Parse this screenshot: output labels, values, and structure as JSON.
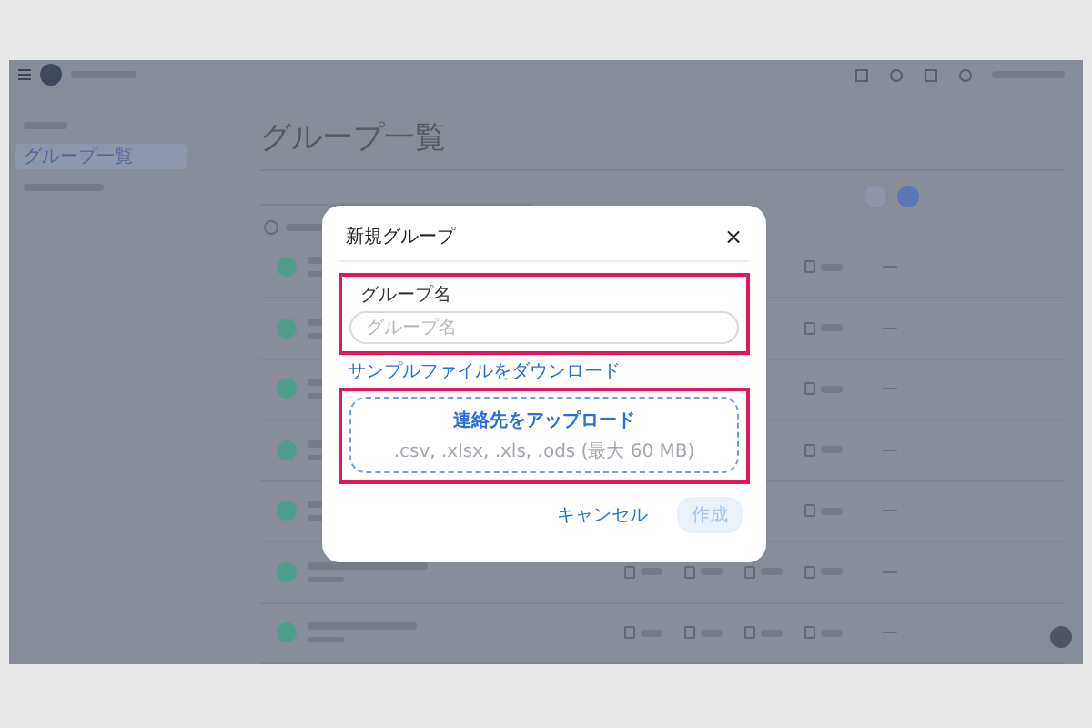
{
  "sidebar": {
    "items": [
      {
        "selected": false
      },
      {
        "label": "グループ一覧",
        "selected": true
      },
      {
        "selected": false
      }
    ]
  },
  "page": {
    "title": "グループ一覧"
  },
  "select_all": {
    "checked": false
  },
  "dialog": {
    "title": "新規グループ",
    "close": "×",
    "name_field": {
      "label": "グループ名",
      "placeholder": "グループ名"
    },
    "sample_link": "サンプルファイルをダウンロード",
    "upload": {
      "title": "連絡先をアップロード",
      "hint": ".csv, .xlsx, .xls, .ods (最大 60 MB)"
    },
    "buttons": [
      {
        "label": "キャンセル",
        "kind": "text",
        "disabled": false
      },
      {
        "label": "作成",
        "kind": "primary",
        "disabled": true
      }
    ]
  }
}
